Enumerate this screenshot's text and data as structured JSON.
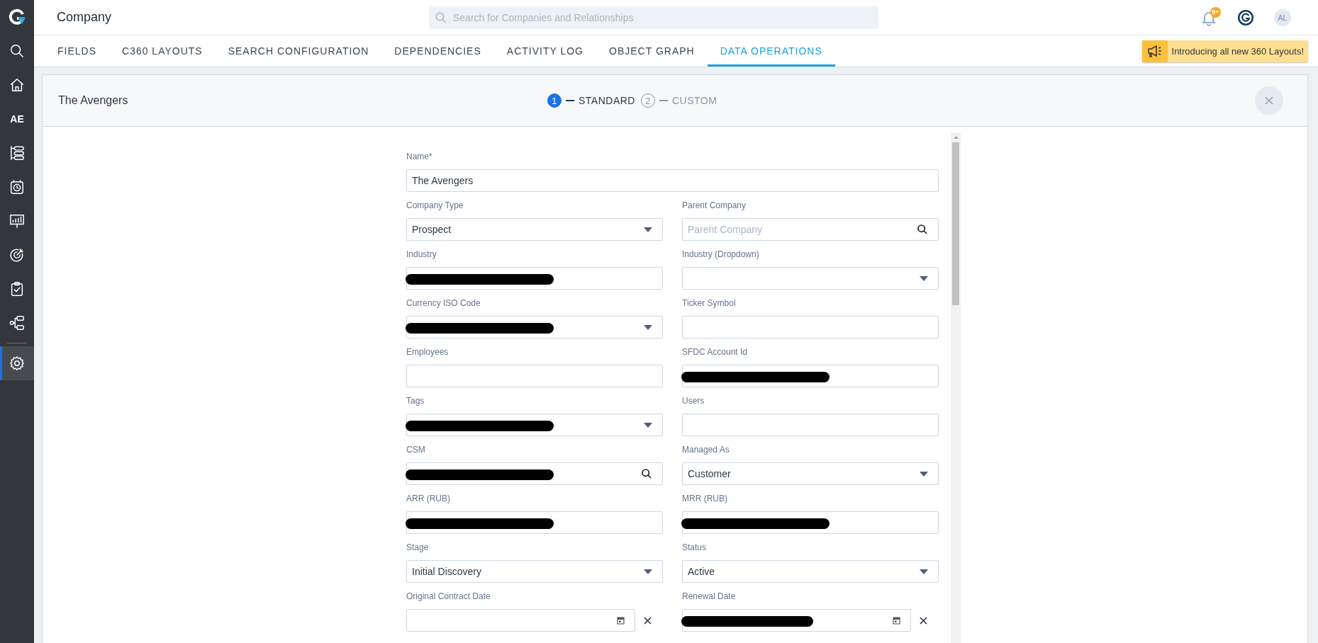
{
  "sidebar": {
    "items": [
      {
        "kind": "logo",
        "selected": false
      },
      {
        "kind": "search",
        "selected": false
      },
      {
        "kind": "home",
        "selected": false
      },
      {
        "kind": "text",
        "label": "AE",
        "selected": false
      },
      {
        "kind": "list",
        "selected": false
      },
      {
        "kind": "calendar",
        "selected": false
      },
      {
        "kind": "chart",
        "selected": false
      },
      {
        "kind": "target",
        "selected": false
      },
      {
        "kind": "clipboard",
        "selected": false
      },
      {
        "kind": "hierarchy",
        "selected": false
      },
      {
        "kind": "settings",
        "selected": true
      }
    ]
  },
  "topbar": {
    "title": "Company",
    "search": {
      "placeholder": "Search for Companies and Relationships"
    },
    "notification_badge": "9+",
    "avatar": "AL"
  },
  "tabs": [
    {
      "label": "FIELDS",
      "selected": false
    },
    {
      "label": "C360 LAYOUTS",
      "selected": false
    },
    {
      "label": "SEARCH CONFIGURATION",
      "selected": false
    },
    {
      "label": "DEPENDENCIES",
      "selected": false
    },
    {
      "label": "ACTIVITY LOG",
      "selected": false
    },
    {
      "label": "OBJECT GRAPH",
      "selected": false
    },
    {
      "label": "DATA OPERATIONS",
      "selected": true
    }
  ],
  "banner": {
    "text": "Introducing all new 360 Layouts!"
  },
  "panel": {
    "title": "The Avengers",
    "steps": [
      {
        "number": "1",
        "label": "STANDARD",
        "selected": true
      },
      {
        "number": "2",
        "label": "CUSTOM",
        "selected": false
      }
    ],
    "name_field": {
      "label": "Name*",
      "kind": "text",
      "value": "The Avengers"
    },
    "fields": [
      {
        "label": "Company Type",
        "kind": "select",
        "value": "Prospect"
      },
      {
        "label": "Parent Company",
        "kind": "lookup",
        "placeholder": "Parent Company"
      },
      {
        "label": "Industry",
        "kind": "text",
        "redacted": true
      },
      {
        "label": "Industry (Dropdown)",
        "kind": "select"
      },
      {
        "label": "Currency ISO Code",
        "kind": "select",
        "redacted": true
      },
      {
        "label": "Ticker Symbol",
        "kind": "text"
      },
      {
        "label": "Employees",
        "kind": "text"
      },
      {
        "label": "SFDC Account Id",
        "kind": "text",
        "redacted": true
      },
      {
        "label": "Tags",
        "kind": "select",
        "redacted": true
      },
      {
        "label": "Users",
        "kind": "text"
      },
      {
        "label": "CSM",
        "kind": "lookup",
        "redacted": true
      },
      {
        "label": "Managed As",
        "kind": "select",
        "value": "Customer"
      },
      {
        "label": "ARR (RUB)",
        "kind": "text",
        "redacted": true
      },
      {
        "label": "MRR (RUB)",
        "kind": "text",
        "redacted": true
      },
      {
        "label": "Stage",
        "kind": "select",
        "value": "Initial Discovery"
      },
      {
        "label": "Status",
        "kind": "select",
        "value": "Active"
      },
      {
        "label": "Original Contract Date",
        "kind": "date"
      },
      {
        "label": "Renewal Date",
        "kind": "date",
        "redacted": true
      }
    ]
  }
}
